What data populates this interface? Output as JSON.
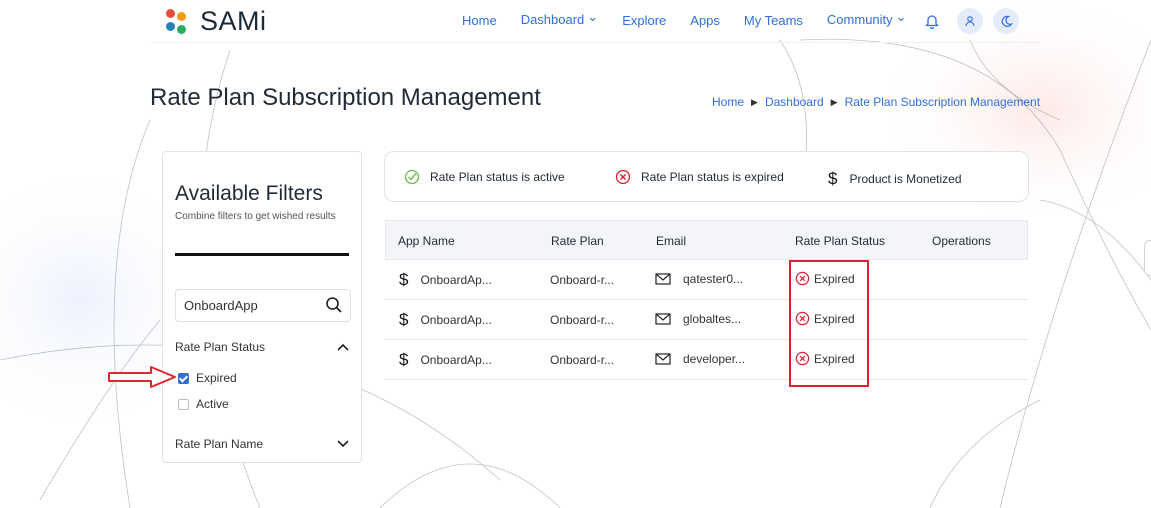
{
  "header": {
    "logo_text": "SAMi",
    "nav": [
      {
        "label": "Home",
        "dropdown": false
      },
      {
        "label": "Dashboard",
        "dropdown": true
      },
      {
        "label": "Explore",
        "dropdown": false
      },
      {
        "label": "Apps",
        "dropdown": false
      },
      {
        "label": "My Teams",
        "dropdown": false
      },
      {
        "label": "Community",
        "dropdown": true
      }
    ],
    "icons": [
      "bell-icon",
      "user-icon",
      "moon-icon"
    ]
  },
  "page": {
    "title": "Rate Plan Subscription Management",
    "breadcrumb": [
      "Home",
      "Dashboard",
      "Rate Plan Subscription Management"
    ]
  },
  "filters": {
    "title": "Available Filters",
    "subtitle": "Combine filters to get wished results",
    "search_value": "OnboardApp",
    "status_section": "Rate Plan Status",
    "options": [
      {
        "label": "Expired",
        "checked": true
      },
      {
        "label": "Active",
        "checked": false
      }
    ],
    "name_section": "Rate Plan Name"
  },
  "legend": {
    "active": "Rate Plan status is active",
    "expired": "Rate Plan status is expired",
    "monetized": "Product is Monetized"
  },
  "table": {
    "headers": [
      "App Name",
      "Rate Plan",
      "Email",
      "Rate Plan Status",
      "Operations"
    ],
    "rows": [
      {
        "app": "OnboardAp...",
        "plan": "Onboard-r...",
        "email": "qatester0...",
        "status": "Expired"
      },
      {
        "app": "OnboardAp...",
        "plan": "Onboard-r...",
        "email": "globaltes...",
        "status": "Expired"
      },
      {
        "app": "OnboardAp...",
        "plan": "Onboard-r...",
        "email": "developer...",
        "status": "Expired"
      }
    ]
  },
  "colors": {
    "accent": "#2f6fda",
    "expired": "#d9202f",
    "active": "#6cbf4a",
    "highlight": "#d9202f"
  }
}
